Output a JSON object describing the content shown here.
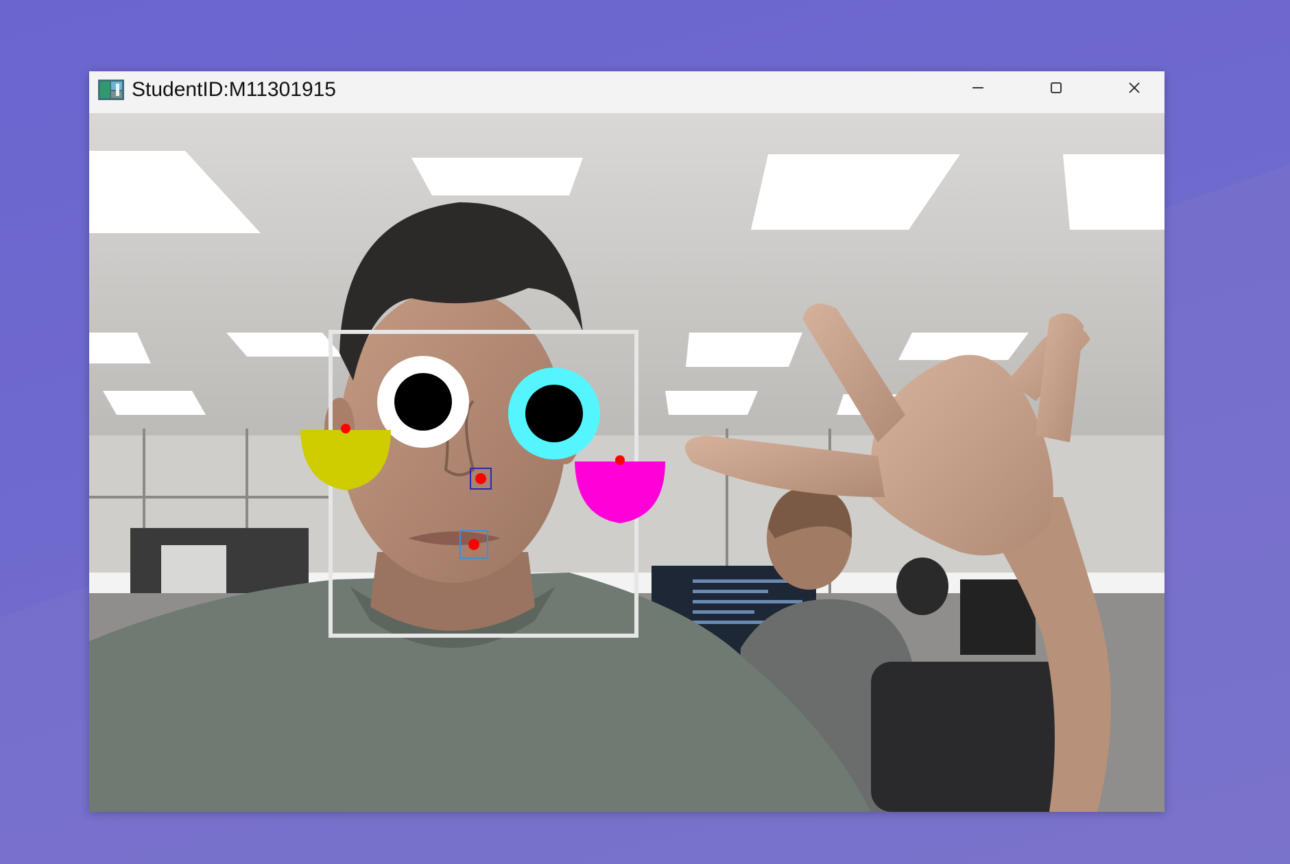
{
  "window": {
    "title": "StudentID:M11301915",
    "icon": "opencv-window-icon",
    "controls": [
      {
        "name": "minimize-button",
        "icon": "minimize-icon"
      },
      {
        "name": "maximize-button",
        "icon": "maximize-icon"
      },
      {
        "name": "close-button",
        "icon": "close-icon"
      }
    ]
  },
  "overlay": {
    "face_box_color": "#e6e6e6",
    "left_eye": {
      "ring_color": "#ffffff",
      "pupil_color": "#000000"
    },
    "right_eye": {
      "ring_color": "#55f5ff",
      "pupil_color": "#000000"
    },
    "left_cheek_color": "#cfcc00",
    "right_cheek_color": "#ff00d8",
    "landmark_color": "#ff0000",
    "nose_box_color": "#2a2aaa",
    "mouth_box_color": "#3d8fd6"
  },
  "colors": {
    "background": "#6d68cf",
    "titlebar": "#f3f3f3",
    "shirt": "#6f7a72",
    "hair": "#2c2a28",
    "skin": "#b58a73"
  }
}
